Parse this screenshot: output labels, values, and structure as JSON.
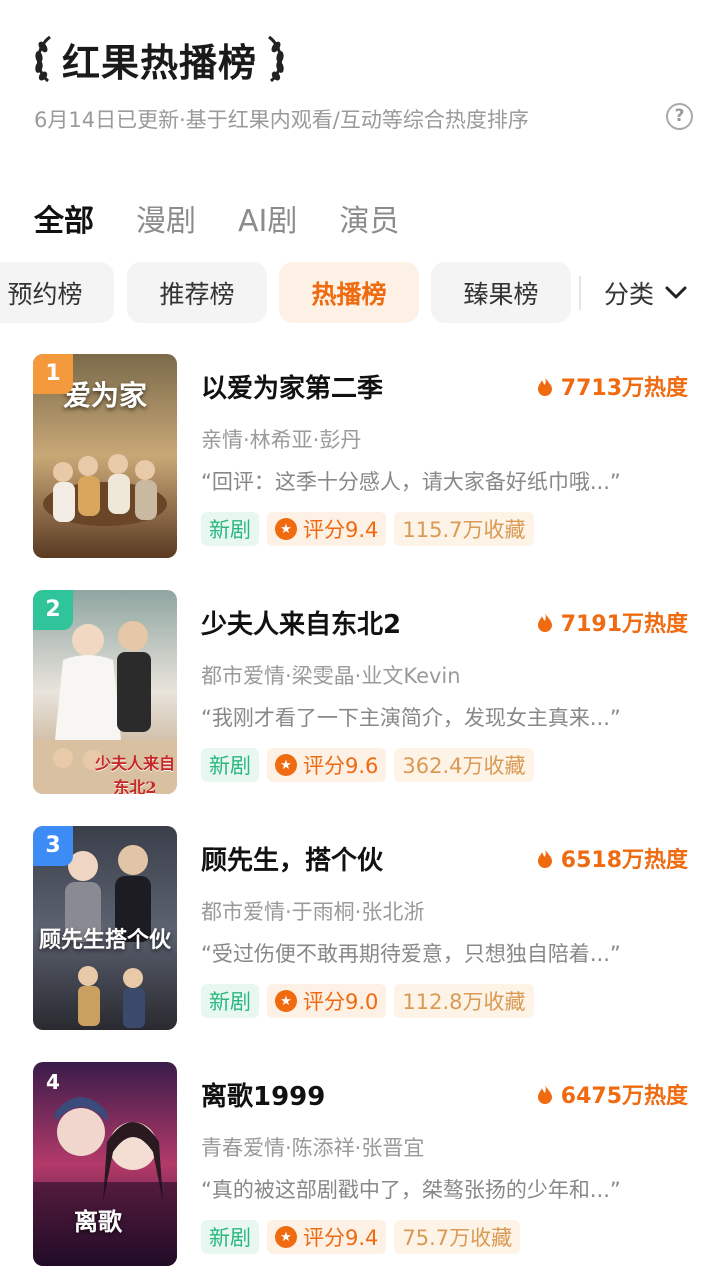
{
  "header": {
    "title": "红果热播榜",
    "subtitle": "6月14日已更新·基于红果内观看/互动等综合热度排序",
    "help_icon": "?"
  },
  "tabs": [
    "全部",
    "漫剧",
    "AI剧",
    "演员"
  ],
  "active_tab": "全部",
  "chips": [
    "预约榜",
    "推荐榜",
    "热播榜",
    "臻果榜"
  ],
  "active_chip": "热播榜",
  "category_label": "分类",
  "colors": {
    "accent": "#f06a10",
    "rank1": "#f59a3c",
    "rank2": "#2fc49a",
    "rank3": "#3d8cf5",
    "new_badge": "#2bb77f"
  },
  "items": [
    {
      "rank": "1",
      "title": "以爱为家第二季",
      "heat": "7713万热度",
      "meta": "亲情·林希亚·彭丹",
      "quote": "“回评：这季十分感人，请大家备好纸巾哦...”",
      "badge_new": "新剧",
      "score": "评分9.4",
      "favorites": "115.7万收藏",
      "poster_text": "爱为家"
    },
    {
      "rank": "2",
      "title": "少夫人来自东北2",
      "heat": "7191万热度",
      "meta": "都市爱情·梁雯晶·业文Kevin",
      "quote": "“我刚才看了一下主演简介，发现女主真来...”",
      "badge_new": "新剧",
      "score": "评分9.6",
      "favorites": "362.4万收藏",
      "poster_text": "少夫人来自东北2"
    },
    {
      "rank": "3",
      "title": "顾先生，搭个伙",
      "heat": "6518万热度",
      "meta": "都市爱情·于雨桐·张北浙",
      "quote": "“受过伤便不敢再期待爱意，只想独自陪着...”",
      "badge_new": "新剧",
      "score": "评分9.0",
      "favorites": "112.8万收藏",
      "poster_text": "顾先生搭个伙"
    },
    {
      "rank": "4",
      "title": "离歌1999",
      "heat": "6475万热度",
      "meta": "青春爱情·陈添祥·张晋宜",
      "quote": "“真的被这部剧戳中了，桀骜张扬的少年和...”",
      "badge_new": "新剧",
      "score": "评分9.4",
      "favorites": "75.7万收藏",
      "poster_text": "离歌"
    }
  ]
}
